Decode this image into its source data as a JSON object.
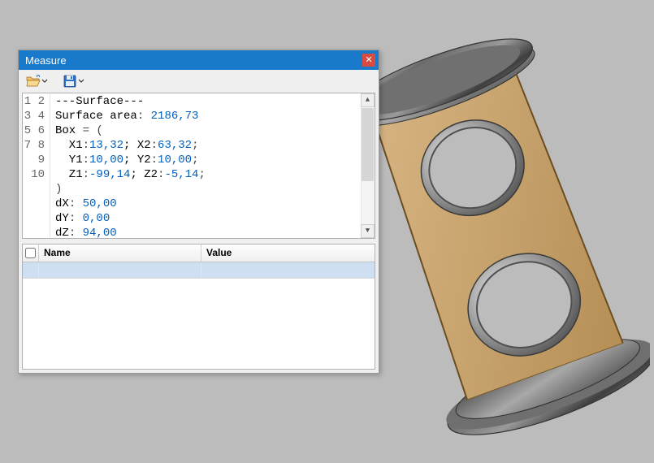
{
  "window": {
    "title": "Measure"
  },
  "code": {
    "lines": [
      {
        "n": "1",
        "segs": [
          {
            "t": "---Surface---",
            "c": ""
          }
        ]
      },
      {
        "n": "2",
        "segs": [
          {
            "t": "Surface area",
            "c": ""
          },
          {
            "t": ": ",
            "c": "sym"
          },
          {
            "t": "2186,73",
            "c": "num"
          }
        ]
      },
      {
        "n": "3",
        "segs": [
          {
            "t": "Box ",
            "c": ""
          },
          {
            "t": "= (",
            "c": "sym"
          }
        ]
      },
      {
        "n": "4",
        "segs": [
          {
            "t": "  X1",
            "c": ""
          },
          {
            "t": ":",
            "c": "sym"
          },
          {
            "t": "13,32",
            "c": "num"
          },
          {
            "t": "; X2",
            "c": ""
          },
          {
            "t": ":",
            "c": "sym"
          },
          {
            "t": "63,32",
            "c": "num"
          },
          {
            "t": ";",
            "c": "sym"
          }
        ]
      },
      {
        "n": "5",
        "segs": [
          {
            "t": "  Y1",
            "c": ""
          },
          {
            "t": ":",
            "c": "sym"
          },
          {
            "t": "10,00",
            "c": "num"
          },
          {
            "t": "; Y2",
            "c": ""
          },
          {
            "t": ":",
            "c": "sym"
          },
          {
            "t": "10,00",
            "c": "num"
          },
          {
            "t": ";",
            "c": "sym"
          }
        ]
      },
      {
        "n": "6",
        "segs": [
          {
            "t": "  Z1",
            "c": ""
          },
          {
            "t": ":",
            "c": "sym"
          },
          {
            "t": "-99,14",
            "c": "num"
          },
          {
            "t": "; Z2",
            "c": ""
          },
          {
            "t": ":",
            "c": "sym"
          },
          {
            "t": "-5,14",
            "c": "num"
          },
          {
            "t": ";",
            "c": "sym"
          }
        ]
      },
      {
        "n": "7",
        "segs": [
          {
            "t": ")",
            "c": "sym"
          }
        ]
      },
      {
        "n": "8",
        "segs": [
          {
            "t": "dX",
            "c": ""
          },
          {
            "t": ": ",
            "c": "sym"
          },
          {
            "t": "50,00",
            "c": "num"
          }
        ]
      },
      {
        "n": "9",
        "segs": [
          {
            "t": "dY",
            "c": ""
          },
          {
            "t": ": ",
            "c": "sym"
          },
          {
            "t": "0,00",
            "c": "num"
          }
        ]
      },
      {
        "n": "10",
        "segs": [
          {
            "t": "dZ",
            "c": ""
          },
          {
            "t": ": ",
            "c": "sym"
          },
          {
            "t": "94,00",
            "c": "num"
          }
        ]
      }
    ]
  },
  "table": {
    "headers": {
      "name": "Name",
      "value": "Value"
    }
  },
  "colors": {
    "tan": "#c7a168",
    "steel_dark": "#555",
    "steel_light": "#aaa"
  }
}
